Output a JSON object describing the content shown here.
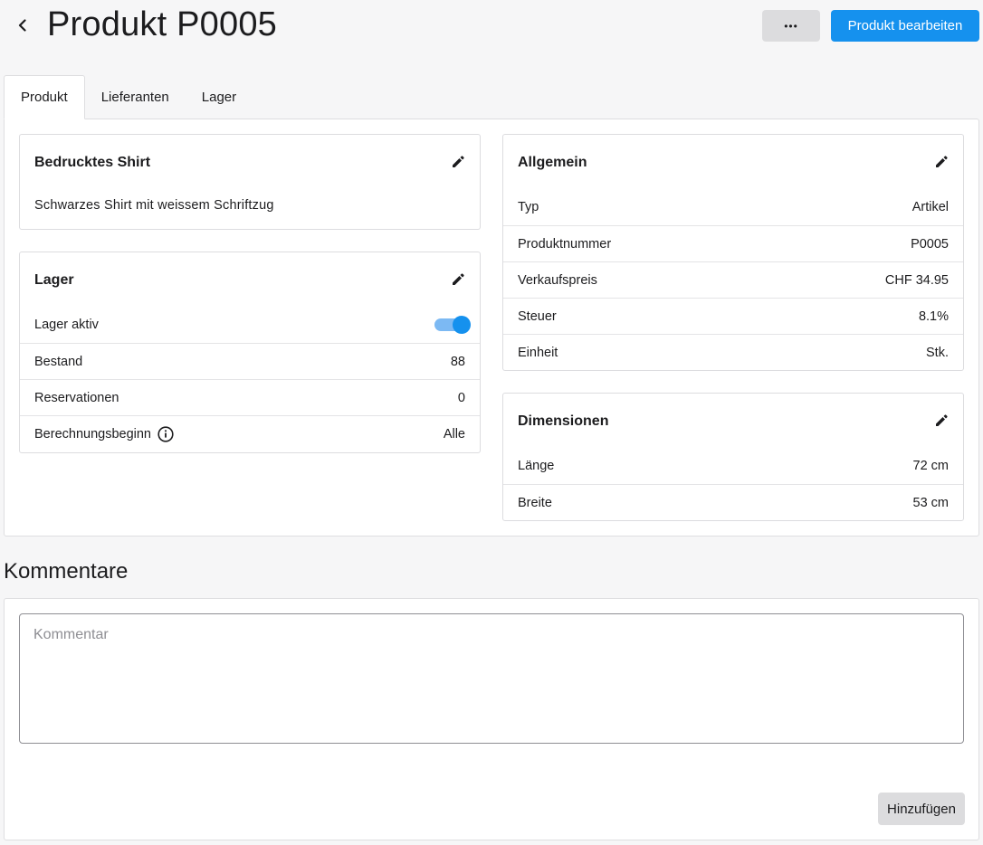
{
  "header": {
    "title": "Produkt P0005",
    "more_label": "•••",
    "edit_label": "Produkt bearbeiten"
  },
  "tabs": [
    {
      "label": "Produkt",
      "active": true
    },
    {
      "label": "Lieferanten",
      "active": false
    },
    {
      "label": "Lager",
      "active": false
    }
  ],
  "product_card": {
    "title": "Bedrucktes Shirt",
    "description": "Schwarzes Shirt mit weissem Schriftzug"
  },
  "stock_card": {
    "title": "Lager",
    "active_label": "Lager aktiv",
    "active": true,
    "rows": [
      {
        "label": "Bestand",
        "value": "88"
      },
      {
        "label": "Reservationen",
        "value": "0"
      },
      {
        "label": "Berechnungsbeginn",
        "value": "Alle"
      }
    ]
  },
  "general_card": {
    "title": "Allgemein",
    "rows": [
      {
        "label": "Typ",
        "value": "Artikel"
      },
      {
        "label": "Produktnummer",
        "value": "P0005"
      },
      {
        "label": "Verkaufspreis",
        "value": "CHF 34.95"
      },
      {
        "label": "Steuer",
        "value": "8.1%"
      },
      {
        "label": "Einheit",
        "value": "Stk."
      }
    ]
  },
  "dimensions_card": {
    "title": "Dimensionen",
    "rows": [
      {
        "label": "Länge",
        "value": "72 cm"
      },
      {
        "label": "Breite",
        "value": "53 cm"
      }
    ]
  },
  "comments": {
    "title": "Kommentare",
    "placeholder": "Kommentar",
    "value": "",
    "add_label": "Hinzufügen"
  },
  "colors": {
    "accent": "#1591ee",
    "toggle_track": "#7cb9f3",
    "button_grey": "#dcdcde",
    "background": "#f6f6f7"
  }
}
